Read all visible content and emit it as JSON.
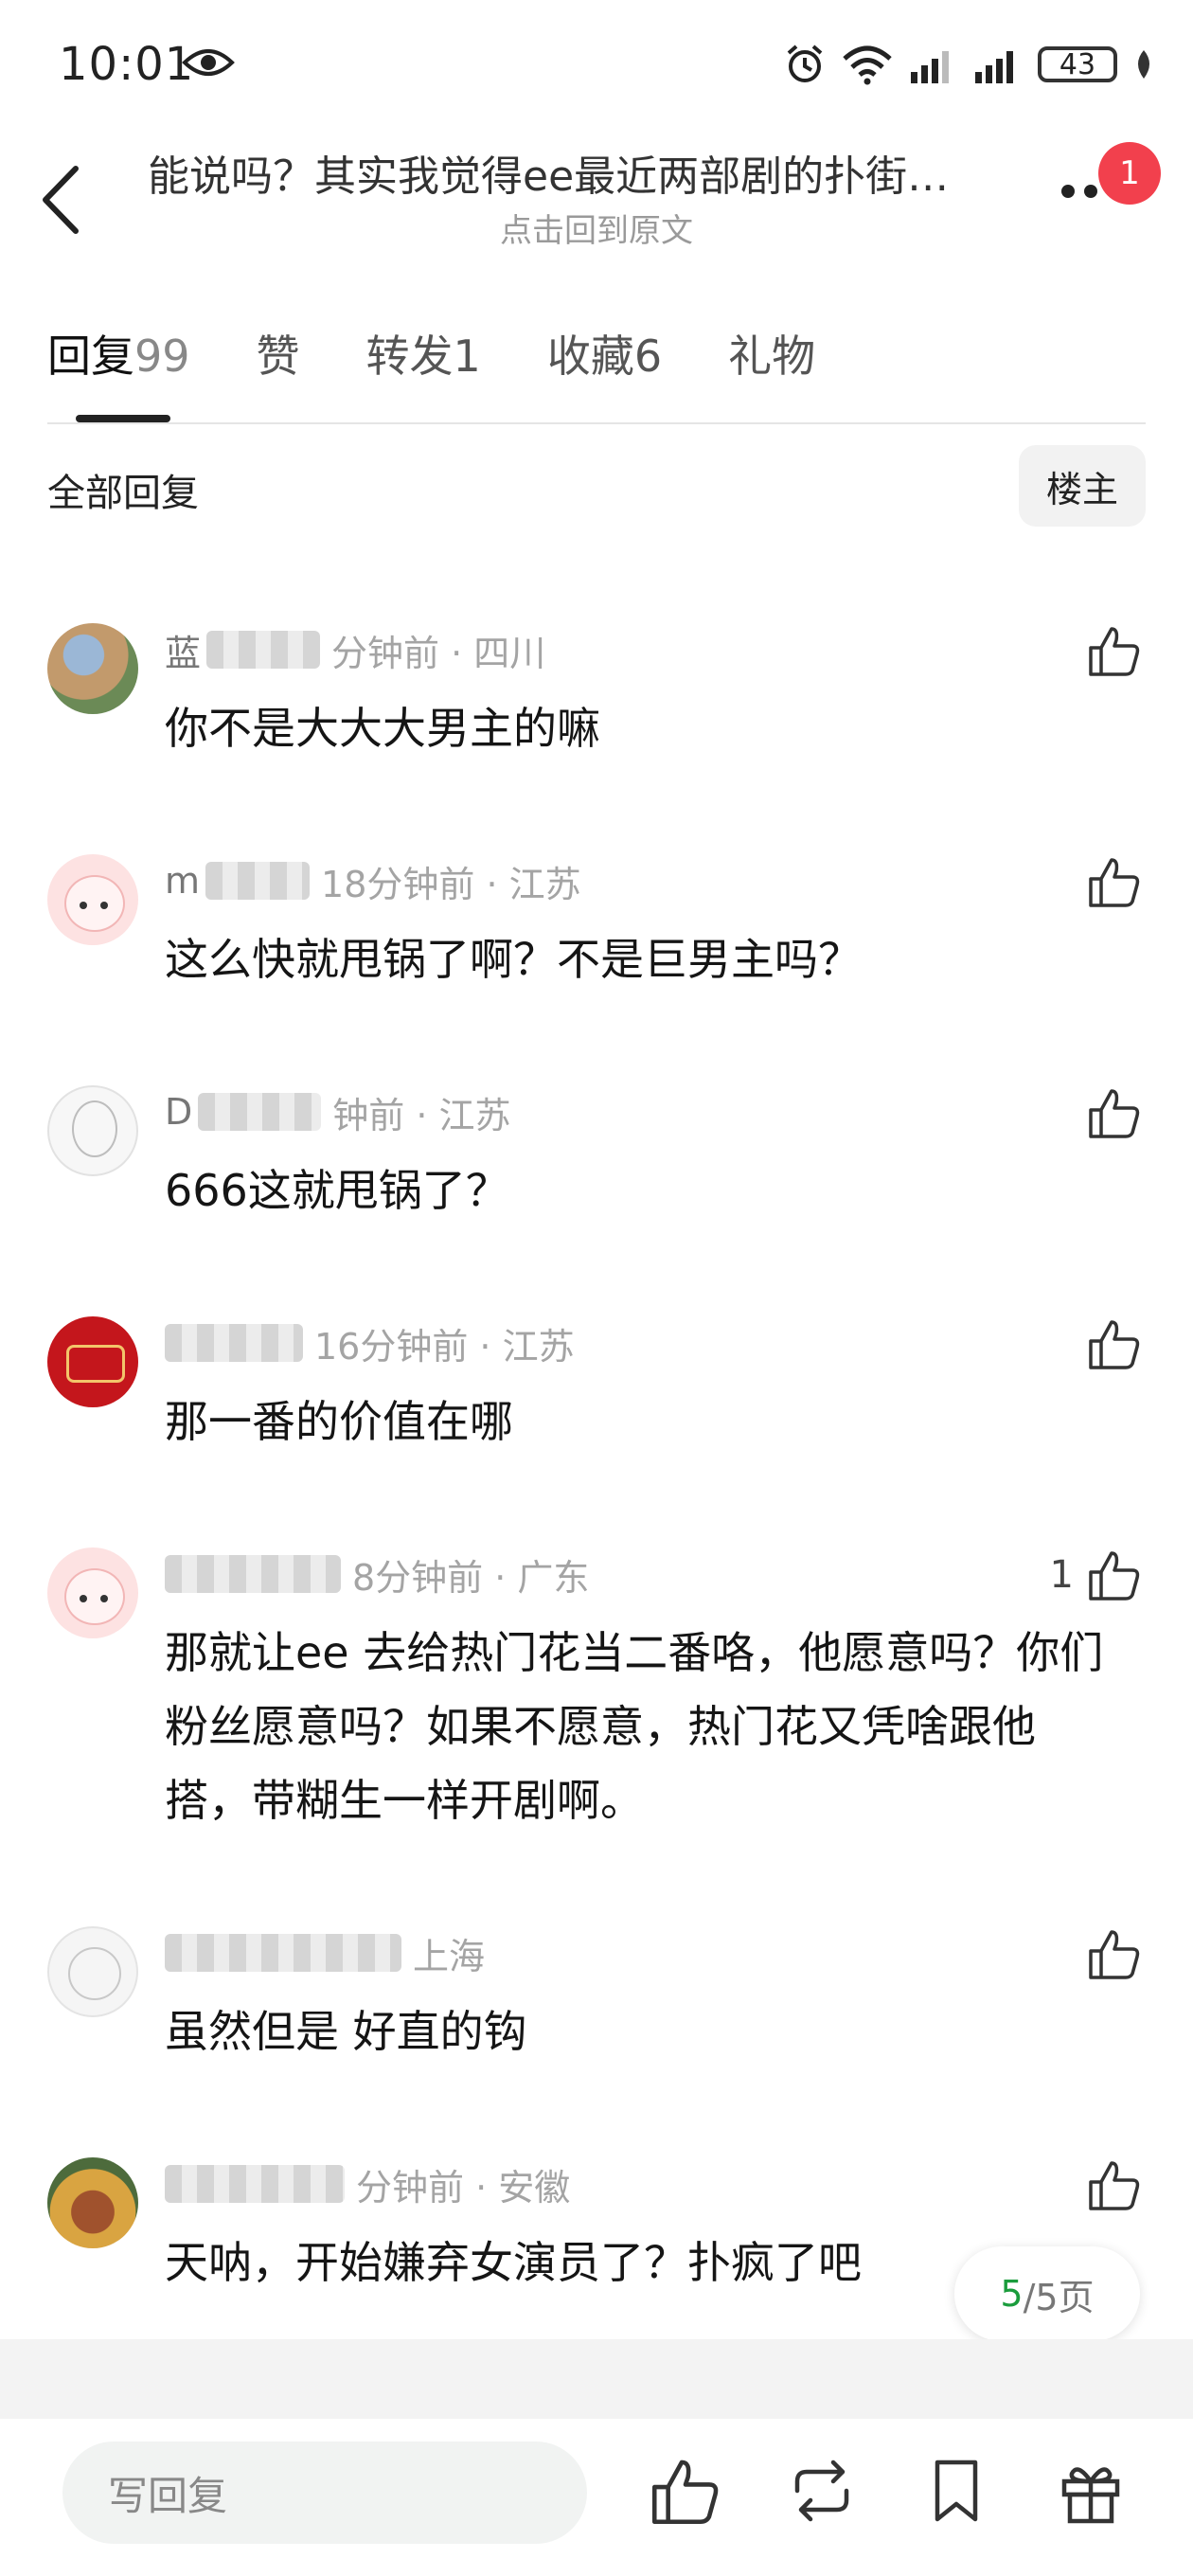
{
  "status_bar": {
    "time": "10:01",
    "battery": "43"
  },
  "header": {
    "title": "能说吗？其实我觉得ee最近两部剧的扑街…",
    "subtitle": "点击回到原文",
    "notification_count": "1"
  },
  "tabs": [
    {
      "label": "回复",
      "count": "99"
    },
    {
      "label": "赞",
      "count": ""
    },
    {
      "label": "转发",
      "count": "1"
    },
    {
      "label": "收藏",
      "count": "6"
    },
    {
      "label": "礼物",
      "count": ""
    }
  ],
  "filter": {
    "label": "全部回复",
    "author_button": "楼主"
  },
  "comments": [
    {
      "name_visible": "蓝",
      "meta": "分钟前 · 四川",
      "text": "你不是大大大男主的嘛",
      "likes": ""
    },
    {
      "name_visible": "m",
      "meta": "18分钟前 · 江苏",
      "text": "这么快就甩锅了啊？不是巨男主吗？",
      "likes": ""
    },
    {
      "name_visible": "D",
      "meta": "钟前 · 江苏",
      "text": "666这就甩锅了？",
      "likes": ""
    },
    {
      "name_visible": "",
      "meta": "16分钟前 · 江苏",
      "text": "那一番的价值在哪",
      "likes": ""
    },
    {
      "name_visible": "",
      "meta": "8分钟前 · 广东",
      "text": "那就让ee 去给热门花当二番咯，他愿意吗？你们粉丝愿意吗？如果不愿意，热门花又凭啥跟他搭，带糊生一样开剧啊。",
      "likes": "1"
    },
    {
      "name_visible": "",
      "meta": "上海",
      "text": "虽然但是 好直的钩",
      "likes": ""
    },
    {
      "name_visible": "",
      "meta": "分钟前 · 安徽",
      "text": "天呐，开始嫌弃女演员了？扑疯了吧",
      "likes": ""
    }
  ],
  "pager": {
    "current": "5",
    "total": "/5页"
  },
  "bottom_bar": {
    "reply_placeholder": "写回复"
  }
}
